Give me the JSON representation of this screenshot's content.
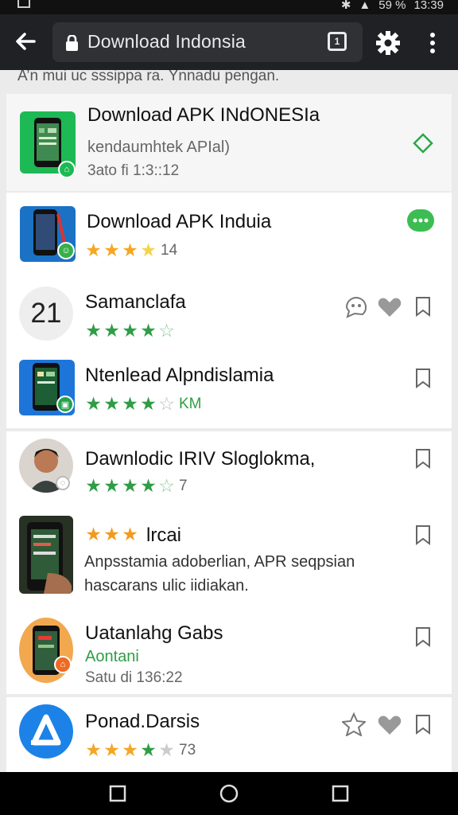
{
  "status_bar": {
    "battery": "59 %",
    "time": "13:39"
  },
  "toolbar": {
    "url": "Download Indonsia",
    "tab_count": "1"
  },
  "intro": "A’n mui uc sssippa ra. Ÿnnadu pengan.",
  "apps": [
    {
      "title": "Download APK INdONESIa",
      "subtitle": "kendaumhtek APIal)",
      "meta": "3ato fi 1:3::12"
    },
    {
      "title": "Download APK Induia",
      "rating": "14",
      "stars": [
        1,
        1,
        1,
        1,
        0
      ]
    },
    {
      "title": "Samanclafa",
      "icon_text": "21",
      "stars": [
        1,
        1,
        1,
        1,
        0
      ]
    },
    {
      "title": "Ntenlead Alpndislamia",
      "rating": "KM",
      "stars": [
        1,
        1,
        1,
        1,
        0
      ]
    },
    {
      "title": "Dawnlodic IRIV Sloglokma,",
      "rating": "7",
      "stars": [
        1,
        1,
        1,
        1,
        0
      ]
    },
    {
      "title": "lrcai",
      "desc_1": "Anpsstamia adoberlian, APR seqpsian",
      "desc_2": "hascarans ulic iidiakan.",
      "stars": [
        1,
        1,
        1,
        0,
        0
      ]
    },
    {
      "title": "Uatanlahg Gabs",
      "subtitle": "Aontani",
      "meta": "Satu di 136:22"
    },
    {
      "title": "Ponad.Darsis",
      "rating": "73",
      "stars": [
        1,
        1,
        1,
        1,
        0
      ]
    }
  ]
}
